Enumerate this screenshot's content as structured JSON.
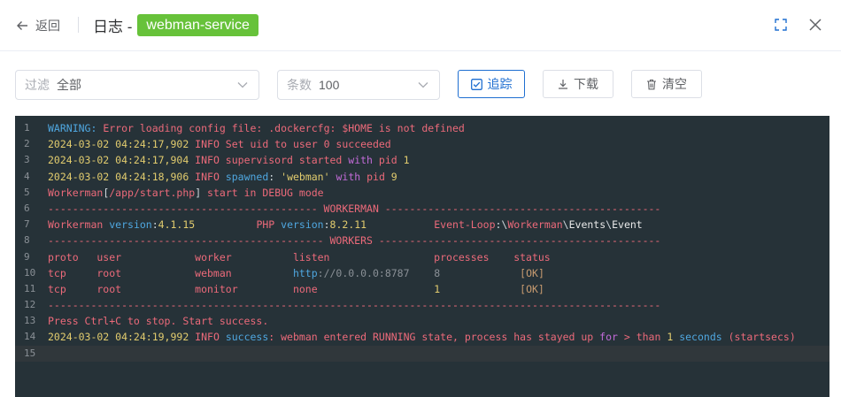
{
  "header": {
    "back_label": "返回",
    "title": "日志 -",
    "service_tag": "webman-service",
    "tag_color": "#67c23a"
  },
  "toolbar": {
    "filter_prefix": "过滤",
    "filter_value": "全部",
    "count_prefix": "条数",
    "count_value": "100",
    "follow_label": "追踪",
    "follow_checked": true,
    "download_label": "下载",
    "clear_label": "清空",
    "accent_color": "#1f6fd1"
  },
  "console": {
    "background": "#263238",
    "current_line": 15,
    "lines": [
      {
        "n": "1",
        "segs": [
          [
            "WARNING:",
            "b"
          ],
          [
            " Error loading config file: .dockercfg: $HOME is not defined",
            "r"
          ]
        ]
      },
      {
        "n": "2",
        "segs": [
          [
            "2024-03-02 04:24:17,902",
            "y"
          ],
          [
            " INFO",
            "r"
          ],
          [
            " Set uid to user 0 succeeded",
            "r"
          ]
        ]
      },
      {
        "n": "3",
        "segs": [
          [
            "2024-03-02 04:24:17,904",
            "y"
          ],
          [
            " INFO",
            "r"
          ],
          [
            " supervisord started ",
            "r"
          ],
          [
            "with",
            "p"
          ],
          [
            " pid ",
            "r"
          ],
          [
            "1",
            "y"
          ]
        ]
      },
      {
        "n": "4",
        "segs": [
          [
            "2024-03-02 04:24:18,906",
            "y"
          ],
          [
            " INFO",
            "r"
          ],
          [
            " ",
            "r"
          ],
          [
            "spawned",
            "b"
          ],
          [
            ": ",
            "w"
          ],
          [
            "'webman'",
            "y"
          ],
          [
            " ",
            "r"
          ],
          [
            "with",
            "p"
          ],
          [
            " pid ",
            "r"
          ],
          [
            "9",
            "y"
          ]
        ]
      },
      {
        "n": "5",
        "segs": [
          [
            "Workerman",
            "r"
          ],
          [
            "[",
            "w"
          ],
          [
            "/app/start.php",
            "r"
          ],
          [
            "]",
            "w"
          ],
          [
            " start in DEBUG mode",
            "r"
          ]
        ]
      },
      {
        "n": "6",
        "segs": [
          [
            "-------------------------------------------- WORKERMAN ---------------------------------------------",
            "r"
          ]
        ]
      },
      {
        "n": "7",
        "segs": [
          [
            "Workerman ",
            "r"
          ],
          [
            "version",
            "b"
          ],
          [
            ":",
            "w"
          ],
          [
            "4.1.15",
            "y"
          ],
          [
            "          PHP ",
            "r"
          ],
          [
            "version",
            "b"
          ],
          [
            ":",
            "w"
          ],
          [
            "8.2.11",
            "y"
          ],
          [
            "           Event-Loop",
            "r"
          ],
          [
            ":\\",
            "w"
          ],
          [
            "Workerman",
            "r"
          ],
          [
            "\\",
            "w"
          ],
          [
            "Events",
            "t"
          ],
          [
            "\\",
            "w"
          ],
          [
            "Event",
            "t"
          ]
        ]
      },
      {
        "n": "8",
        "segs": [
          [
            "--------------------------------------------- WORKERS ----------------------------------------------",
            "r"
          ]
        ]
      },
      {
        "n": "9",
        "segs": [
          [
            "proto   user            worker          listen                 processes    status",
            "r"
          ]
        ]
      },
      {
        "n": "10",
        "segs": [
          [
            "tcp     root            webman          ",
            "r"
          ],
          [
            "http",
            "b"
          ],
          [
            "://0.0.0.0:8787",
            "g"
          ],
          [
            "    ",
            "r"
          ],
          [
            "8",
            "g"
          ],
          [
            "             ",
            "r"
          ],
          [
            "[OK]",
            "m"
          ]
        ]
      },
      {
        "n": "11",
        "segs": [
          [
            "tcp     root            monitor         none                   ",
            "r"
          ],
          [
            "1",
            "y"
          ],
          [
            "             ",
            "r"
          ],
          [
            "[OK]",
            "m"
          ]
        ]
      },
      {
        "n": "12",
        "segs": [
          [
            "----------------------------------------------------------------------------------------------------",
            "r"
          ]
        ]
      },
      {
        "n": "13",
        "segs": [
          [
            "Press Ctrl+C to stop. Start success.",
            "r"
          ]
        ]
      },
      {
        "n": "14",
        "segs": [
          [
            "2024-03-02 04:24:19,992",
            "y"
          ],
          [
            " INFO",
            "r"
          ],
          [
            " ",
            "r"
          ],
          [
            "success",
            "b"
          ],
          [
            ": webman entered RUNNING state, process has stayed up ",
            "r"
          ],
          [
            "for",
            "p"
          ],
          [
            " > than ",
            "r"
          ],
          [
            "1",
            "y"
          ],
          [
            " ",
            "r"
          ],
          [
            "seconds",
            "b"
          ],
          [
            " (startsecs)",
            "r"
          ]
        ]
      },
      {
        "n": "15",
        "segs": []
      }
    ]
  }
}
